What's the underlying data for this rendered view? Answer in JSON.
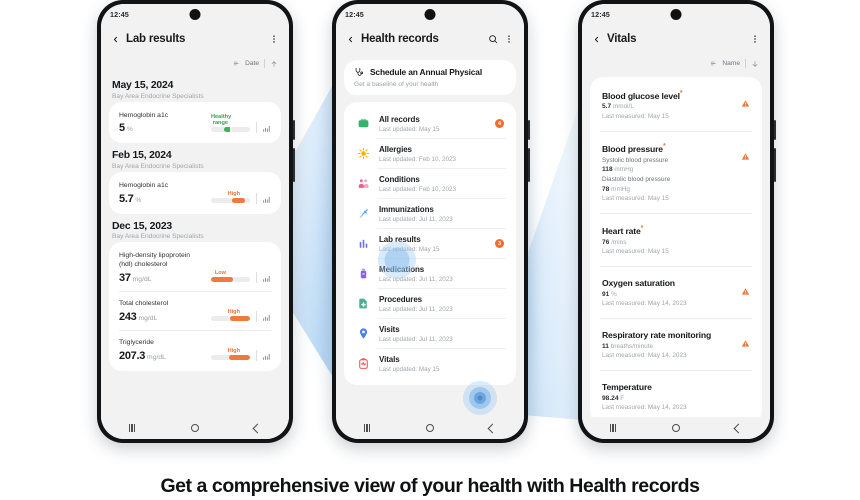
{
  "caption": "Get a comprehensive view of your health with Health records",
  "colors": {
    "accent_orange": "#ef6c2b",
    "healthy_green": "#35a353",
    "warn_orange": "#e8763a",
    "screen_bg": "#f2f2f3",
    "card_bg": "#ffffff",
    "glow_blue": "#add3f4"
  },
  "phones": [
    {
      "id": "lab-results",
      "status": {
        "time": "12:45"
      },
      "appbar": {
        "back_icon": "chevron-left-icon",
        "title": "Lab results",
        "menu_icon": "more-vertical-icon"
      },
      "sort": {
        "sort_icon": "sort-icon",
        "label": "Date",
        "order_icon": "arrow-up-icon"
      },
      "groups": [
        {
          "date": "May 15, 2024",
          "provider": "Bay Area Endocrine Specialists",
          "rows": [
            {
              "name": "Hemoglobin a1c",
              "value": "5",
              "unit": "%",
              "tag": "Healthy range",
              "tag_kind": "healthy",
              "fill_start": 33,
              "fill_width": 22,
              "chart_icon": "bar-chart-icon"
            }
          ]
        },
        {
          "date": "Feb 15, 2024",
          "provider": "Bay Area Endocrine Specialists",
          "rows": [
            {
              "name": "Hemoglobin a1c",
              "value": "5.7",
              "unit": "%",
              "tag": "High",
              "tag_kind": "high",
              "fill_start": 55,
              "fill_width": 32,
              "chart_icon": "bar-chart-icon"
            }
          ]
        },
        {
          "date": "Dec 15, 2023",
          "provider": "Bay Area Endocrine Specialists",
          "rows": [
            {
              "name": "High-density lipoprotein (hdl) cholesterol",
              "value": "37",
              "unit": "mg/dL",
              "tag": "Low",
              "tag_kind": "low",
              "fill_start": 0,
              "fill_width": 57,
              "chart_icon": "bar-chart-icon"
            },
            {
              "name": "Total cholesterol",
              "value": "243",
              "unit": "mg/dL",
              "tag": "High",
              "tag_kind": "high",
              "fill_start": 48,
              "fill_width": 52,
              "chart_icon": "bar-chart-icon"
            },
            {
              "name": "Triglyceride",
              "value": "207.3",
              "unit": "mg/dL",
              "tag": "High",
              "tag_kind": "high",
              "fill_start": 45,
              "fill_width": 55,
              "chart_icon": "bar-chart-icon"
            }
          ]
        }
      ],
      "nav": {
        "recents_icon": "recents-icon",
        "home_icon": "home-icon",
        "back_icon": "back-icon"
      }
    },
    {
      "id": "health-records",
      "status": {
        "time": "12:45"
      },
      "appbar": {
        "back_icon": "chevron-left-icon",
        "title": "Health records",
        "search_icon": "search-icon",
        "menu_icon": "more-vertical-icon"
      },
      "promo": {
        "icon": "stethoscope-icon",
        "title": "Schedule an Annual Physical",
        "subtitle": "Get a baseline of your health"
      },
      "records": [
        {
          "icon": "all-records-icon",
          "color": "#35b36a",
          "name": "All records",
          "updated": "Last updated: May 15",
          "badge": "4"
        },
        {
          "icon": "allergies-icon",
          "color": "#f5b301",
          "name": "Allergies",
          "updated": "Last updated: Feb 10, 2023",
          "badge": ""
        },
        {
          "icon": "conditions-icon",
          "color": "#ef5f8c",
          "name": "Conditions",
          "updated": "Last updated: Feb 10, 2023",
          "badge": ""
        },
        {
          "icon": "immunizations-icon",
          "color": "#46a7f0",
          "name": "Immunizations",
          "updated": "Last updated: Jul 11, 2023",
          "badge": ""
        },
        {
          "icon": "lab-results-icon",
          "color": "#6d6ff0",
          "name": "Lab results",
          "updated": "Last updated: May 15",
          "badge": "3"
        },
        {
          "icon": "medications-icon",
          "color": "#8b5cf6",
          "name": "Medications",
          "updated": "Last updated: Jul 11, 2023",
          "badge": ""
        },
        {
          "icon": "procedures-icon",
          "color": "#23a57f",
          "name": "Procedures",
          "updated": "Last updated: Jul 11, 2023",
          "badge": ""
        },
        {
          "icon": "visits-icon",
          "color": "#4a7df0",
          "name": "Visits",
          "updated": "Last updated: Jul 11, 2023",
          "badge": ""
        },
        {
          "icon": "vitals-icon",
          "color": "#f05a5a",
          "name": "Vitals",
          "updated": "Last updated: May 15",
          "badge": ""
        }
      ],
      "nav": {
        "recents_icon": "recents-icon",
        "home_icon": "home-icon",
        "back_icon": "back-icon"
      }
    },
    {
      "id": "vitals",
      "status": {
        "time": "12:45"
      },
      "appbar": {
        "back_icon": "chevron-left-icon",
        "title": "Vitals",
        "menu_icon": "more-vertical-icon"
      },
      "sort": {
        "sort_icon": "sort-icon",
        "label": "Name",
        "order_icon": "arrow-down-icon"
      },
      "vitals": [
        {
          "name": "Blood glucose level",
          "asterisk": true,
          "readings": [
            {
              "label": "",
              "value": "5.7",
              "unit": "mmol/L"
            }
          ],
          "measured": "Last measured: May 15",
          "warn": true,
          "warn_icon": "warning-triangle-icon"
        },
        {
          "name": "Blood pressure",
          "asterisk": true,
          "readings": [
            {
              "label": "Systolic blood pressure",
              "value": "118",
              "unit": "mmHg"
            },
            {
              "label": "Diastolic blood pressure",
              "value": "78",
              "unit": "mmHg"
            }
          ],
          "measured": "Last measured: May 15",
          "warn": true,
          "warn_icon": "warning-triangle-icon"
        },
        {
          "name": "Heart rate",
          "asterisk": true,
          "readings": [
            {
              "label": "",
              "value": "76",
              "unit": "/mins"
            }
          ],
          "measured": "Last measured: May 15",
          "warn": false,
          "warn_icon": "warning-triangle-icon"
        },
        {
          "name": "Oxygen saturation",
          "asterisk": false,
          "readings": [
            {
              "label": "",
              "value": "91",
              "unit": "%"
            }
          ],
          "measured": "Last measured: May 14, 2023",
          "warn": true,
          "warn_icon": "warning-triangle-icon"
        },
        {
          "name": "Respiratory rate monitoring",
          "asterisk": false,
          "readings": [
            {
              "label": "",
              "value": "11",
              "unit": "breaths/minute"
            }
          ],
          "measured": "Last measured: May 14, 2023",
          "warn": true,
          "warn_icon": "warning-triangle-icon"
        },
        {
          "name": "Temperature",
          "asterisk": false,
          "readings": [
            {
              "label": "",
              "value": "98.24",
              "unit": "F"
            }
          ],
          "measured": "Last measured: May 14, 2023",
          "warn": false,
          "warn_icon": "warning-triangle-icon"
        }
      ],
      "nav": {
        "recents_icon": "recents-icon",
        "home_icon": "home-icon",
        "back_icon": "back-icon"
      }
    }
  ]
}
